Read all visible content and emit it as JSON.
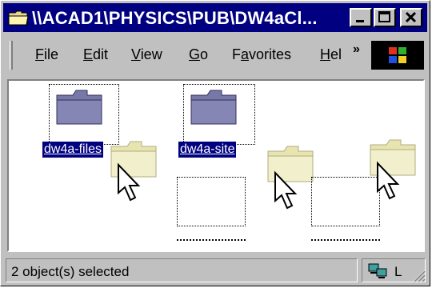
{
  "window": {
    "title": "\\\\ACAD1\\PHYSICS\\PUB\\DW4aCl...",
    "controls": {
      "minimize": "minimize",
      "maximize": "maximize",
      "close": "close"
    }
  },
  "menu": {
    "items": [
      {
        "label": "File",
        "accel": "F",
        "rest": "ile"
      },
      {
        "label": "Edit",
        "accel": "E",
        "rest": "dit"
      },
      {
        "label": "View",
        "accel": "V",
        "rest": "iew"
      },
      {
        "label": "Go",
        "accel": "G",
        "rest": "o"
      },
      {
        "label": "Favorites",
        "pre": "F",
        "accel": "a",
        "rest": "vorites"
      },
      {
        "label": "Hel",
        "accel": "H",
        "rest": "el"
      }
    ],
    "overflow_label": "»"
  },
  "content": {
    "items": [
      {
        "label": "dw4a-files",
        "selected": true,
        "icon": "folder-icon"
      },
      {
        "label": "dw4a-site",
        "selected": true,
        "icon": "folder-icon"
      }
    ]
  },
  "status": {
    "selection_text": "2 object(s) selected",
    "zone_text": "L"
  },
  "colors": {
    "titlebar": "#000080",
    "selection": "#000080",
    "folder_dark": "#7070a0",
    "folder_drag": "#f0eec0"
  }
}
